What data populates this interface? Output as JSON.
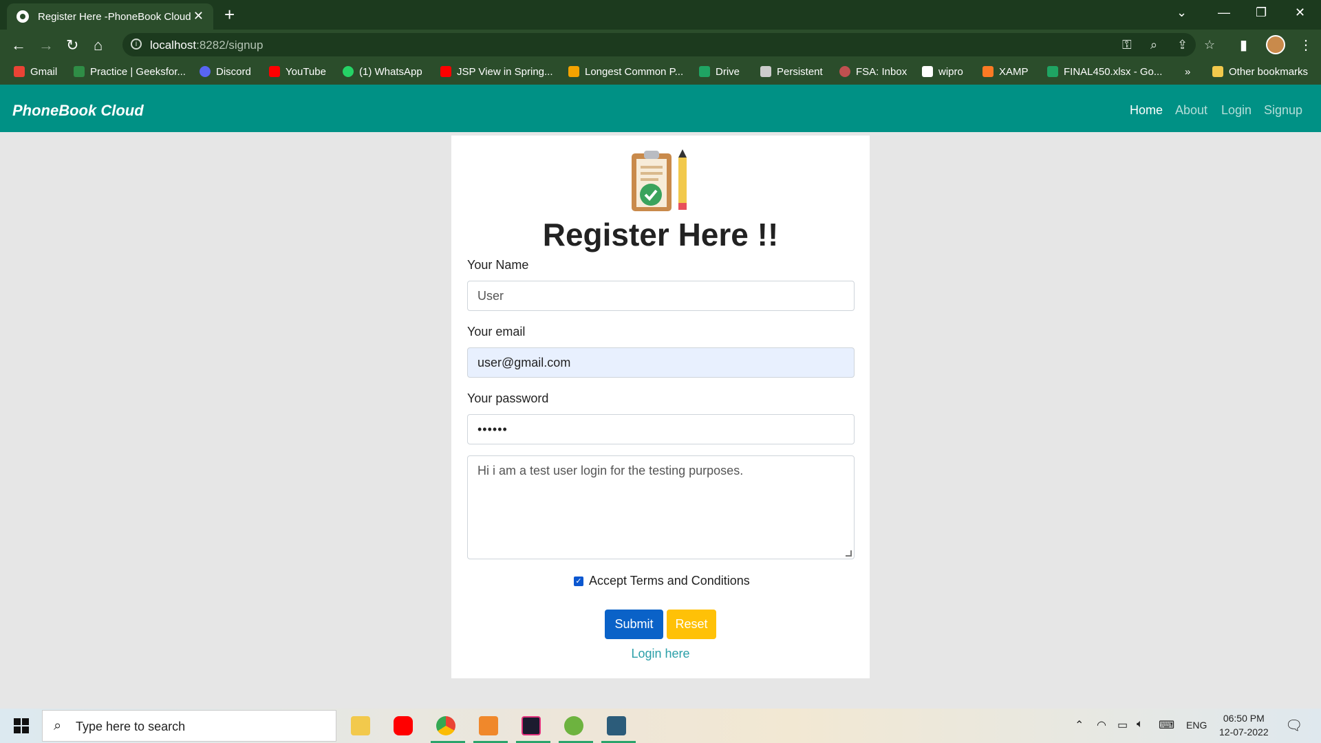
{
  "browser": {
    "tab_title": "Register Here -PhoneBook Cloud",
    "url_host": "localhost",
    "url_rest": ":8282/signup",
    "bookmarks": [
      {
        "label": "Gmail",
        "color": "#ea4335"
      },
      {
        "label": "Practice | Geeksfor...",
        "color": "#2f8d46"
      },
      {
        "label": "Discord",
        "color": "#5865f2"
      },
      {
        "label": "YouTube",
        "color": "#ff0000"
      },
      {
        "label": "(1) WhatsApp",
        "color": "#25d366"
      },
      {
        "label": "JSP View in Spring...",
        "color": "#ff0000"
      },
      {
        "label": "Longest Common P...",
        "color": "#f4a300"
      },
      {
        "label": "Drive",
        "color": "#1fa463"
      },
      {
        "label": "Persistent",
        "color": "#cccccc"
      },
      {
        "label": "FSA: Inbox",
        "color": "#c05050"
      },
      {
        "label": "wipro",
        "color": "#ffffff"
      },
      {
        "label": "XAMP",
        "color": "#fb7a24"
      },
      {
        "label": "FINAL450.xlsx - Go...",
        "color": "#1fa463"
      }
    ],
    "bookmarks_overflow": "»",
    "other_bookmarks": "Other bookmarks"
  },
  "navbar": {
    "brand": "PhoneBook Cloud",
    "links": [
      "Home",
      "About",
      "Login",
      "Signup"
    ]
  },
  "form": {
    "heading": "Register Here !!",
    "name_label": "Your Name",
    "name_value": "User",
    "email_label": "Your email",
    "email_value": "user@gmail.com",
    "password_label": "Your password",
    "password_value": "••••••",
    "about_value": "Hi i am a test user login for the testing purposes.",
    "terms_label": "Accept Terms and Conditions",
    "submit_label": "Submit",
    "reset_label": "Reset",
    "login_link": "Login here"
  },
  "taskbar": {
    "search_placeholder": "Type here to search",
    "lang": "ENG",
    "time": "06:50 PM",
    "date": "12-07-2022"
  },
  "colors": {
    "navbar": "#009185",
    "submit": "#0a62c8",
    "reset": "#ffc107",
    "link": "#2a9fa8"
  }
}
